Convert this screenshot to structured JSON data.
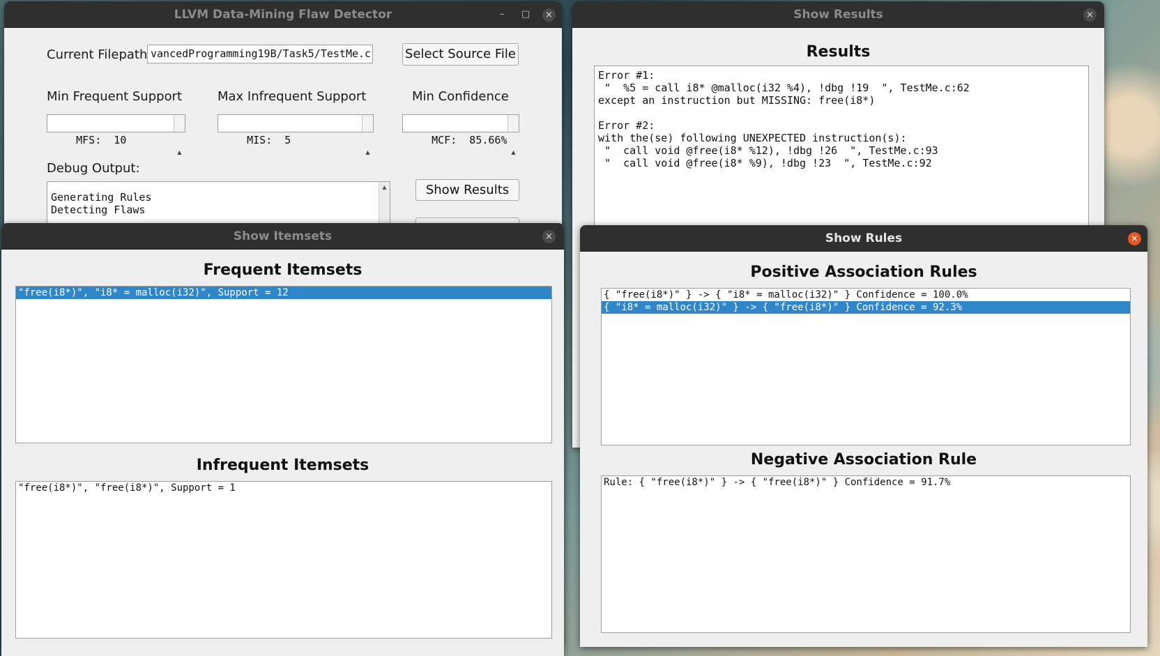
{
  "main_window": {
    "title": "LLVM Data-Mining Flaw Detector",
    "minimize_label": "–",
    "maximize_label": "□",
    "close_label": "×",
    "filepath_label": "Current Filepath:",
    "filepath_value": "vancedProgramming19B/Task5/TestMe.c",
    "select_source_label": "Select Source File",
    "min_frequent_support_label": "Min Frequent Support",
    "max_infrequent_support_label": "Max Infrequent Support",
    "min_confidence_label": "Min Confidence",
    "mfs_value": "MFS:  10",
    "mis_value": "MIS:  5",
    "mcf_value": "MCF:  85.66%",
    "spin_up": "▲",
    "spin_down": "▼",
    "debug_output_label": "Debug Output:",
    "debug_lines": [
      "Generating Rules",
      "Detecting Flaws"
    ],
    "show_results_label": "Show Results"
  },
  "results_window": {
    "title": "Show Results",
    "close_label": "×",
    "heading": "Results",
    "lines": [
      "Error #1:",
      " \"  %5 = call i8* @malloc(i32 %4), !dbg !19  \", TestMe.c:62",
      "except an instruction but MISSING: free(i8*)",
      "",
      "Error #2:",
      "with the(se) following UNEXPECTED instruction(s):",
      " \"  call void @free(i8* %12), !dbg !26  \", TestMe.c:93",
      " \"  call void @free(i8* %9), !dbg !23  \", TestMe.c:92"
    ]
  },
  "itemsets_window": {
    "title": "Show Itemsets",
    "close_label": "×",
    "frequent_heading": "Frequent Itemsets",
    "frequent_items": [
      "\"free(i8*)\", \"i8* = malloc(i32)\", Support = 12"
    ],
    "infrequent_heading": "Infrequent Itemsets",
    "infrequent_items": [
      "\"free(i8*)\", \"free(i8*)\", Support = 1"
    ]
  },
  "rules_window": {
    "title": "Show Rules",
    "close_label": "×",
    "positive_heading": "Positive Association Rules",
    "positive_rules": [
      "{ \"free(i8*)\" } -> { \"i8* = malloc(i32)\" } Confidence = 100.0%",
      "{ \"i8* = malloc(i32)\" } -> { \"free(i8*)\" } Confidence = 92.3%"
    ],
    "negative_heading": "Negative Association Rule",
    "negative_rules": [
      "Rule: { \"free(i8*)\" } -> { \"free(i8*)\" } Confidence = 91.7%"
    ]
  },
  "colors": {
    "selection": "#2f86c9",
    "titlebar": "#2f2f2f",
    "close_active": "#e95420",
    "window_bg": "#efefef"
  }
}
